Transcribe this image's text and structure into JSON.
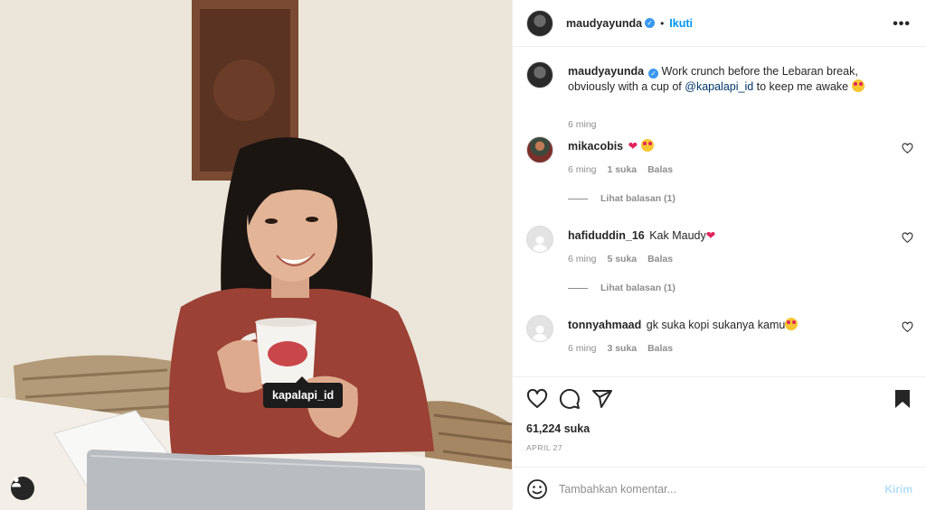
{
  "post": {
    "username": "maudyayunda",
    "follow_label": "Ikuti",
    "dot": "•",
    "more": "•••"
  },
  "caption": {
    "username": "maudyayunda",
    "text_before": "Work crunch before the Lebaran break, obviously with a cup of ",
    "mention": "@kapalapi_id",
    "text_after": " to keep me awake ",
    "time": "6 ming"
  },
  "comments": [
    {
      "username": "mikacobis",
      "text": "",
      "time": "6 ming",
      "likes": "1 suka",
      "reply": "Balas",
      "view_replies": "Lihat balasan (1)"
    },
    {
      "username": "hafiduddin_16",
      "text": "Kak Maudy",
      "time": "6 ming",
      "likes": "5 suka",
      "reply": "Balas",
      "view_replies": "Lihat balasan (1)"
    },
    {
      "username": "tonnyahmaad",
      "text": "gk suka kopi sukanya kamu",
      "time": "6 ming",
      "likes": "3 suka",
      "reply": "Balas"
    }
  ],
  "photo_tag": "kapalapi_id",
  "stats": {
    "likes": "61,224 suka",
    "date": "APRIL 27"
  },
  "add_comment": {
    "placeholder": "Tambahkan komentar...",
    "post_label": "Kirim"
  },
  "colors": {
    "link": "#0095f6",
    "mention": "#00376b",
    "verified": "#3897f0",
    "heart": "#e0245e"
  }
}
